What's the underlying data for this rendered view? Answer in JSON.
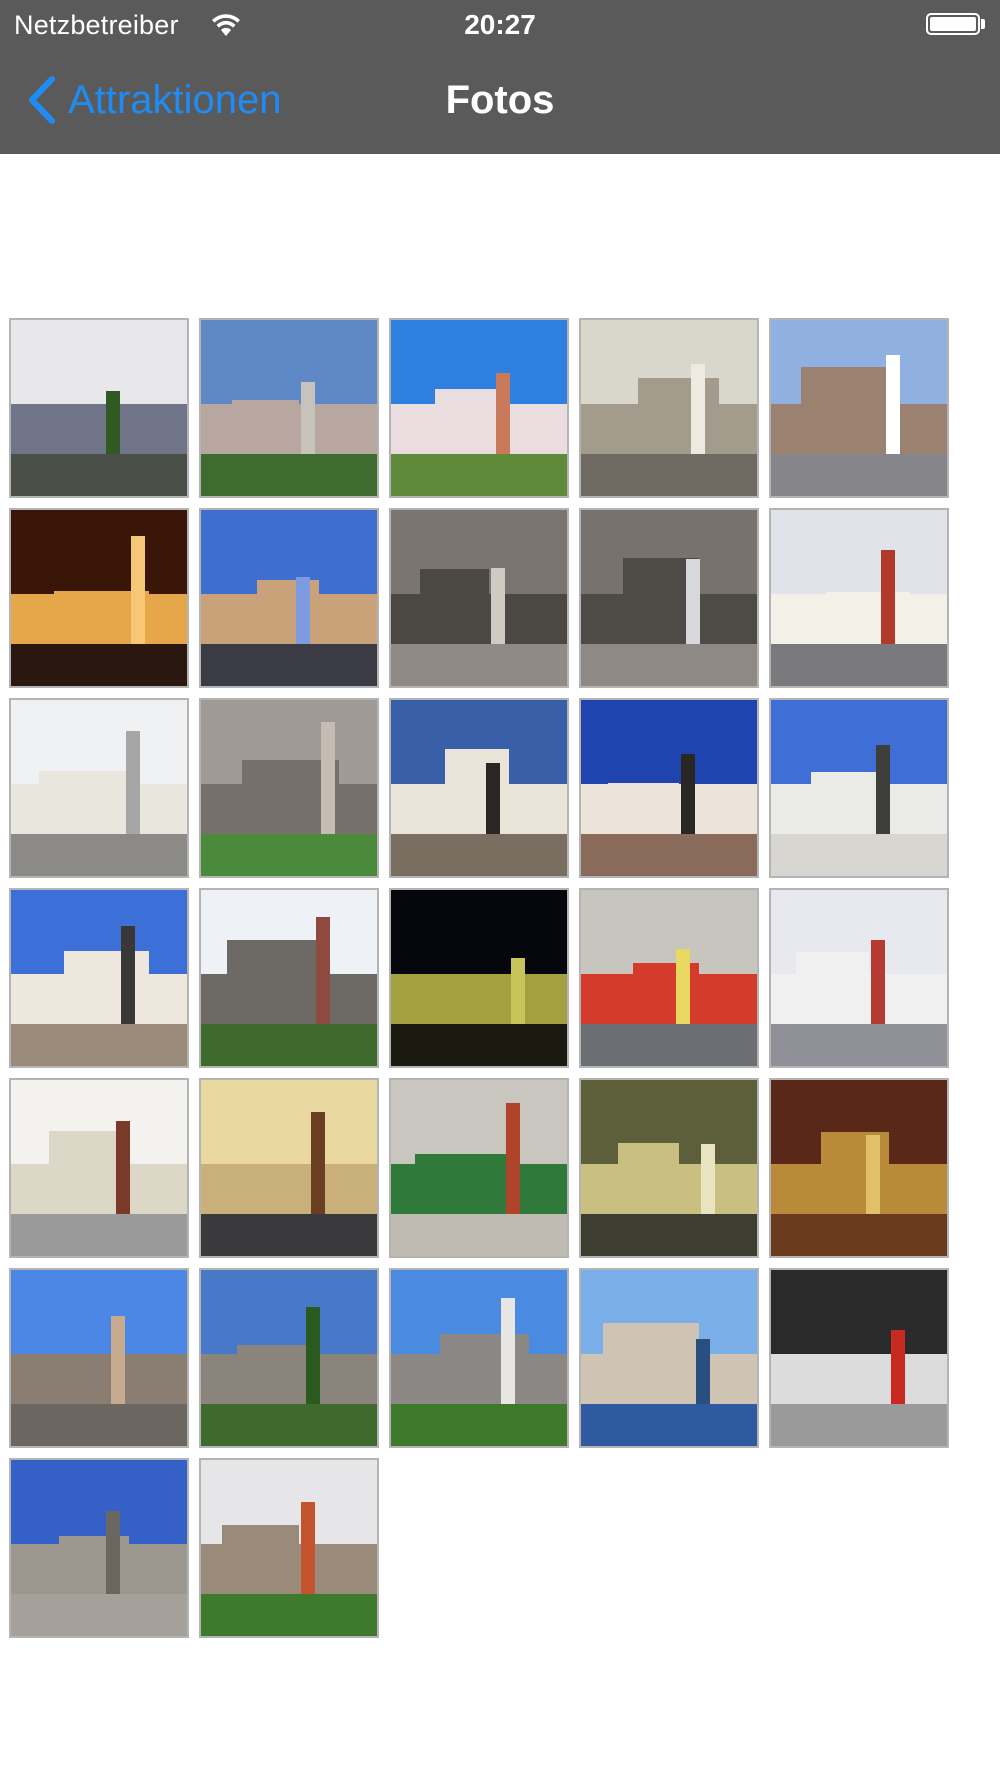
{
  "status_bar": {
    "carrier": "Netzbetreiber",
    "time": "20:27",
    "wifi_icon": "wifi-icon",
    "battery_icon": "battery-icon"
  },
  "nav": {
    "back_label": "Attraktionen",
    "back_icon": "chevron-left-icon",
    "title": "Fotos",
    "accent_color": "#1f8cf5",
    "bar_color": "#5a5a5a"
  },
  "photos": [
    {
      "sky": "#e8e8ec",
      "mid": "#6f7488",
      "ground": "#4a4f48",
      "accent": "#2f5a22"
    },
    {
      "sky": "#5f88c6",
      "mid": "#b7a7a0",
      "ground": "#3e6b2f",
      "accent": "#c8c2bc"
    },
    {
      "sky": "#2f7fe0",
      "mid": "#e9dde0",
      "ground": "#5e8a3a",
      "accent": "#c87a5a"
    },
    {
      "sky": "#d9d6cc",
      "mid": "#a39b8c",
      "ground": "#6f6a62",
      "accent": "#eeeae2"
    },
    {
      "sky": "#8fb0e0",
      "mid": "#9b8170",
      "ground": "#86868a",
      "accent": "#ffffff"
    },
    {
      "sky": "#3a1608",
      "mid": "#e6a64a",
      "ground": "#2a1710",
      "accent": "#f5c777"
    },
    {
      "sky": "#3e6fd0",
      "mid": "#caa27a",
      "ground": "#3b3b46",
      "accent": "#7c9be0"
    },
    {
      "sky": "#7a7570",
      "mid": "#4b4743",
      "ground": "#8f8a84",
      "accent": "#cfcbc3"
    },
    {
      "sky": "#77726d",
      "mid": "#4e4a46",
      "ground": "#8e8984",
      "accent": "#d8d8dc"
    },
    {
      "sky": "#e0e4ea",
      "mid": "#f3f0e8",
      "ground": "#7a7a7c",
      "accent": "#b23a2a"
    },
    {
      "sky": "#f0f1f3",
      "mid": "#e9e6dd",
      "ground": "#8c8a86",
      "accent": "#a6a6a6"
    },
    {
      "sky": "#a09a94",
      "mid": "#75706a",
      "ground": "#4a8a3a",
      "accent": "#c5bdb4"
    },
    {
      "sky": "#385fa8",
      "mid": "#eae4d8",
      "ground": "#7a6e60",
      "accent": "#2a2624"
    },
    {
      "sky": "#1f44b0",
      "mid": "#ece4d8",
      "ground": "#8a6a5a",
      "accent": "#2a2624"
    },
    {
      "sky": "#3e6ed6",
      "mid": "#eaeae6",
      "ground": "#d8d6d0",
      "accent": "#3e3e3a"
    },
    {
      "sky": "#3d6fd8",
      "mid": "#eee7dd",
      "ground": "#9a8a7a",
      "accent": "#3a3836"
    },
    {
      "sky": "#eef2f6",
      "mid": "#6d6a65",
      "ground": "#3f6a2e",
      "accent": "#8e4a3e"
    },
    {
      "sky": "#06070c",
      "mid": "#a4a040",
      "ground": "#1a1a10",
      "accent": "#c7c45a"
    },
    {
      "sky": "#c8c4be",
      "mid": "#d43b2a",
      "ground": "#6b6e72",
      "accent": "#e8d860"
    },
    {
      "sky": "#e7e9ee",
      "mid": "#f1f0f0",
      "ground": "#8f9098",
      "accent": "#b53a32"
    },
    {
      "sky": "#f4f2ee",
      "mid": "#ddd7c8",
      "ground": "#9a9a9a",
      "accent": "#7a3a2a"
    },
    {
      "sky": "#e9d8a0",
      "mid": "#c9b07a",
      "ground": "#3a3a3c",
      "accent": "#6a3e22"
    },
    {
      "sky": "#c9c5bf",
      "mid": "#2f7a3a",
      "ground": "#bfbab2",
      "accent": "#b0442a"
    },
    {
      "sky": "#5d5e3a",
      "mid": "#c8bf80",
      "ground": "#3e3e30",
      "accent": "#e8e4c0"
    },
    {
      "sky": "#5a2818",
      "mid": "#b88a3a",
      "ground": "#6a3a1e",
      "accent": "#e2c06a"
    },
    {
      "sky": "#4c87e6",
      "mid": "#8a7e72",
      "ground": "#6c6660",
      "accent": "#c8aa8e"
    },
    {
      "sky": "#4878c8",
      "mid": "#8a847c",
      "ground": "#3e6a2e",
      "accent": "#2a5a1e"
    },
    {
      "sky": "#4a8ae0",
      "mid": "#8a8784",
      "ground": "#3e7a2a",
      "accent": "#e8e6e2"
    },
    {
      "sky": "#7aaee8",
      "mid": "#cfc4b4",
      "ground": "#2f5aa0",
      "accent": "#2a4e80"
    },
    {
      "sky": "#2a2a2a",
      "mid": "#dcdcdc",
      "ground": "#9a9a9a",
      "accent": "#c82a22"
    },
    {
      "sky": "#3460c8",
      "mid": "#9c9890",
      "ground": "#a6a09a",
      "accent": "#6a6660"
    },
    {
      "sky": "#e6e6e8",
      "mid": "#9a8a7a",
      "ground": "#3e7a2e",
      "accent": "#c4542e"
    }
  ]
}
